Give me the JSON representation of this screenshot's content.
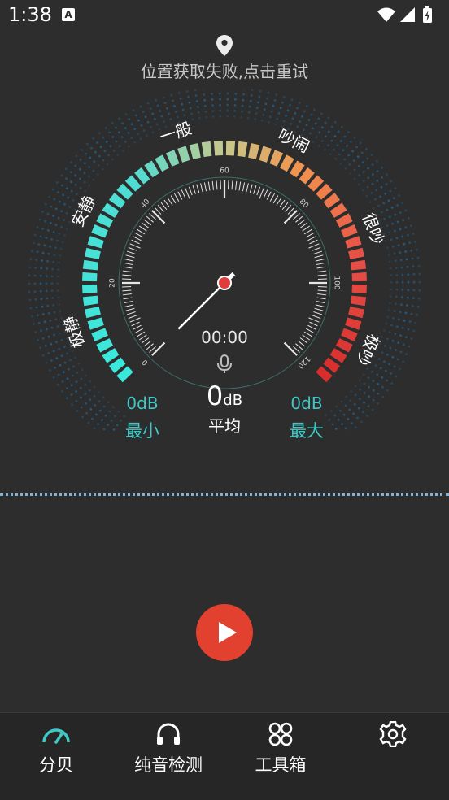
{
  "status_bar": {
    "time": "1:38",
    "notification_icon": "A"
  },
  "location": {
    "icon": "location-pin-icon",
    "message": "位置获取失败,点击重试"
  },
  "gauge": {
    "zone_labels": [
      "极静",
      "安静",
      "一般",
      "吵闹",
      "很吵",
      "极吵"
    ],
    "tick_labels": [
      "0",
      "20",
      "40",
      "60",
      "80",
      "100",
      "120"
    ],
    "needle_value_db": 0,
    "timer": "00:00"
  },
  "stats": {
    "min": {
      "value": "0dB",
      "label": "最小"
    },
    "avg": {
      "value": "0",
      "unit": "dB",
      "label": "平均"
    },
    "max": {
      "value": "0dB",
      "label": "最大"
    }
  },
  "colors": {
    "accent": "#3ec9c6",
    "play_button": "#e2412f",
    "background": "#2d2d2d"
  },
  "nav": {
    "items": [
      {
        "label": "分贝",
        "icon": "speedometer-icon",
        "active": true
      },
      {
        "label": "纯音检测",
        "icon": "headphones-icon",
        "active": false
      },
      {
        "label": "工具箱",
        "icon": "grid-icon",
        "active": false
      },
      {
        "label": "",
        "icon": "gear-icon",
        "active": false
      }
    ]
  }
}
